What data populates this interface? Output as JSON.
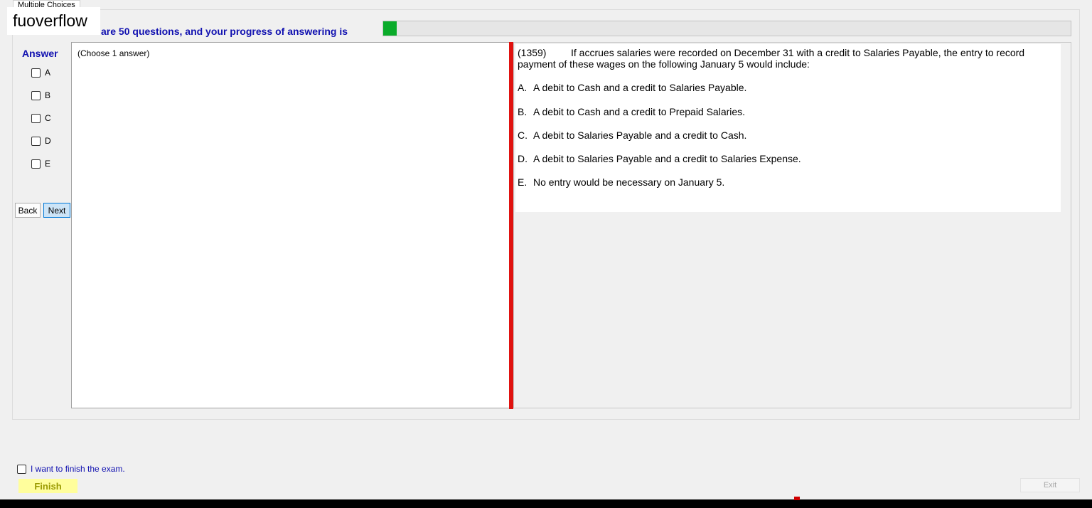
{
  "tab": {
    "label": "Multiple Choices"
  },
  "watermark": "fuoverflow",
  "progress": {
    "text": "There are 50 questions, and your progress of answering is",
    "fraction": 0.02,
    "color": "#0aab2a"
  },
  "answer": {
    "heading": "Answer",
    "options": [
      {
        "label": "A",
        "checked": false
      },
      {
        "label": "B",
        "checked": false
      },
      {
        "label": "C",
        "checked": false
      },
      {
        "label": "D",
        "checked": false
      },
      {
        "label": "E",
        "checked": false
      }
    ]
  },
  "nav": {
    "back_label": "Back",
    "next_label": "Next"
  },
  "left_pane": {
    "instruction": "(Choose 1 answer)"
  },
  "question": {
    "number": "(1359)",
    "stem": "If accrues salaries were recorded on December 31 with a credit to Salaries Payable, the entry to record payment of these wages on the following January 5 would include:",
    "choices": [
      {
        "letter": "A.",
        "text": "A debit to Cash and a credit to Salaries Payable."
      },
      {
        "letter": "B.",
        "text": "A debit to Cash and a credit to Prepaid Salaries."
      },
      {
        "letter": "C.",
        "text": "A debit to Salaries Payable and a credit to Cash."
      },
      {
        "letter": "D.",
        "text": "A debit to Salaries Payable and a credit to Salaries Expense."
      },
      {
        "letter": "E.",
        "text": "No entry would be necessary on January 5."
      }
    ]
  },
  "finish": {
    "checkbox_label": "I want to finish the exam.",
    "checked": false,
    "button_label": "Finish"
  },
  "exit": {
    "label": "Exit"
  },
  "colors": {
    "accent_text": "#1010b0",
    "splitter": "#e0120f",
    "finish_bg": "#fffe9c"
  }
}
